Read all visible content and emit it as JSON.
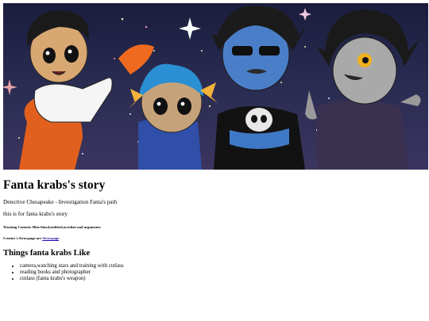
{
  "banner": {
    "alt_icon": "character-art-illustration"
  },
  "page": {
    "title": "Fanta krabs's story",
    "subtitle": "Detective Chesapeake - Investigation Fanta's path",
    "description": "this is for fanta krabs's story",
    "warning": "Warning Content: Blue blood,stabbed,accident and arguments",
    "creator_prefix": "Creator's Strawpage are",
    "creator_link": "Strawpage",
    "creator_suffix": "."
  },
  "likes": {
    "heading": "Things fanta krabs Like",
    "items": [
      "camera,watching stars and training with cutlass",
      "reading books and photographer",
      "cutlass (fanta krabs's weapon)"
    ]
  }
}
